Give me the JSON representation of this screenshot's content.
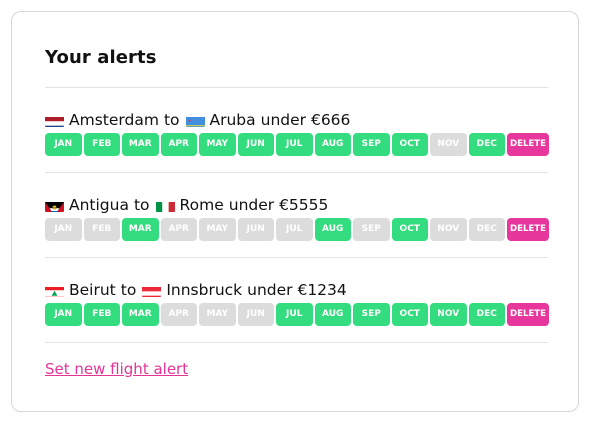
{
  "header": {
    "title": "Your alerts"
  },
  "month_labels": [
    "JAN",
    "FEB",
    "MAR",
    "APR",
    "MAY",
    "JUN",
    "JUL",
    "AUG",
    "SEP",
    "OCT",
    "NOV",
    "DEC"
  ],
  "delete_label": "DELETE",
  "alerts": [
    {
      "from": "Amsterdam",
      "from_flag": "netherlands-flag-icon",
      "to": "Aruba",
      "to_flag": "aruba-flag-icon",
      "under_text": "under €666",
      "months_active": [
        true,
        true,
        true,
        true,
        true,
        true,
        true,
        true,
        true,
        true,
        false,
        true
      ]
    },
    {
      "from": "Antigua",
      "from_flag": "antigua-flag-icon",
      "to": "Rome",
      "to_flag": "italy-flag-icon",
      "under_text": "under €5555",
      "months_active": [
        false,
        false,
        true,
        false,
        false,
        false,
        false,
        true,
        false,
        true,
        false,
        false
      ]
    },
    {
      "from": "Beirut",
      "from_flag": "lebanon-flag-icon",
      "to": "Innsbruck",
      "to_flag": "austria-flag-icon",
      "under_text": "under €1234",
      "months_active": [
        true,
        true,
        true,
        false,
        false,
        false,
        true,
        true,
        true,
        true,
        true,
        true
      ]
    }
  ],
  "connector": "to",
  "new_alert_link": "Set new flight alert",
  "colors": {
    "active": "#33dc7e",
    "inactive": "#dcdcdc",
    "delete": "#e8379c",
    "link": "#e33597"
  }
}
